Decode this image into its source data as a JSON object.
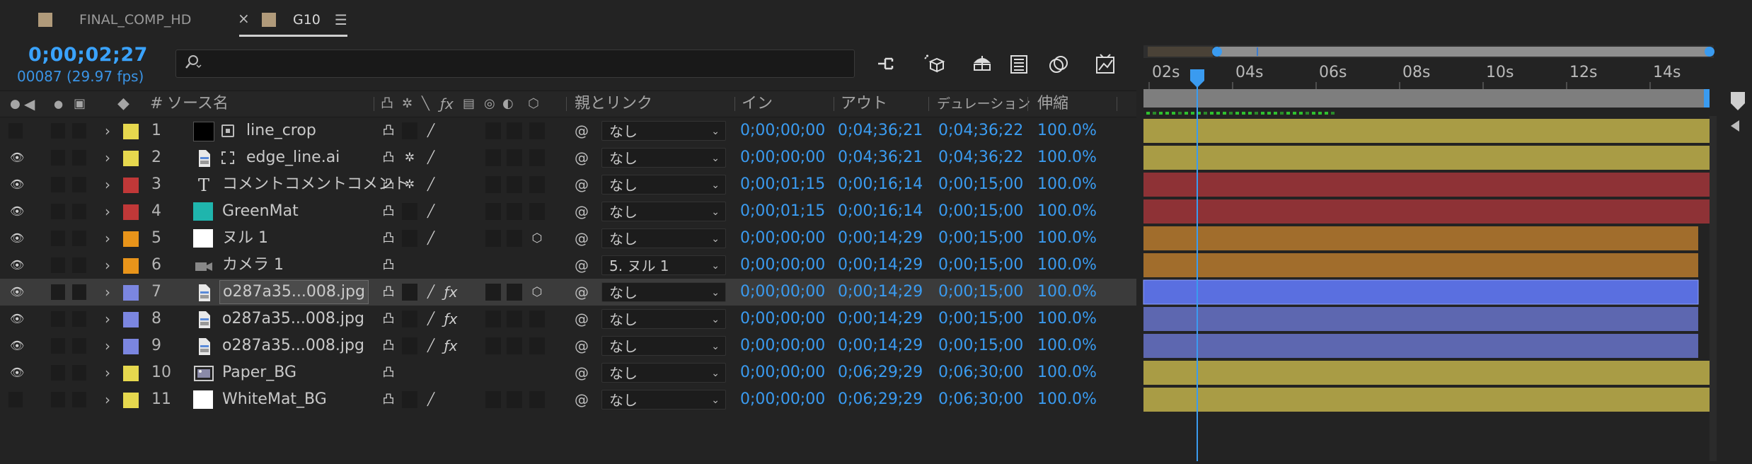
{
  "tabs": [
    {
      "label": "FINAL_COMP_HD",
      "active": false
    },
    {
      "label": "G10",
      "active": true
    }
  ],
  "tab_close_glyph": "×",
  "tab_menu_glyph": "☰",
  "header": {
    "timecode": "0;00;02;27",
    "frames": "00087 (29.97 fps)",
    "search_placeholder": ""
  },
  "columns": {
    "source_name": "ソース名",
    "parent_link": "親とリンク",
    "in": "イン",
    "out": "アウト",
    "duration": "デュレーション",
    "stretch": "伸縮",
    "num": "#"
  },
  "ruler": {
    "labels": [
      "02s",
      "04s",
      "06s",
      "08s",
      "10s",
      "12s",
      "14s"
    ]
  },
  "colors": {
    "yellow": "#e6d84e",
    "red": "#c03838",
    "teal": "#1fb5ad",
    "orange": "#e8941a",
    "blue": "#7b86e0",
    "bar_yellow": "#a99c45",
    "bar_red": "#8e3236",
    "bar_orange": "#a16d2c",
    "bar_blue": "#5d67b0",
    "bar_blue_sel": "#5a6fe0",
    "accent": "#3a9bf0"
  },
  "layers": [
    {
      "num": "1",
      "name": "line_crop",
      "label_color": "#e6d84e",
      "thumb": "black",
      "type_icon": "precomp",
      "parent": "なし",
      "in": "0;00;00;00",
      "out": "0;04;36;21",
      "duration": "0;04;36;22",
      "stretch": "100.0%",
      "eye": false,
      "switches": [
        "shy",
        "blank",
        "pen"
      ],
      "fx": false,
      "three_d": false,
      "bar_color": "#a99c45",
      "bar_end": 1.0,
      "selected": false
    },
    {
      "num": "2",
      "name": "edge_line.ai",
      "label_color": "#e6d84e",
      "thumb": "file",
      "type_icon": "ai",
      "parent": "なし",
      "in": "0;00;00;00",
      "out": "0;04;36;21",
      "duration": "0;04;36;22",
      "stretch": "100.0%",
      "eye": true,
      "switches": [
        "shy",
        "sun",
        "pen"
      ],
      "fx": false,
      "three_d": false,
      "bar_color": "#a99c45",
      "bar_end": 1.0,
      "selected": false
    },
    {
      "num": "3",
      "name": "コメントコメントコメント",
      "label_color": "#c03838",
      "thumb": "text",
      "type_icon": "",
      "parent": "なし",
      "in": "0;00;01;15",
      "out": "0;00;16;14",
      "duration": "0;00;15;00",
      "stretch": "100.0%",
      "eye": true,
      "switches": [
        "shy",
        "sun",
        "pen"
      ],
      "fx": false,
      "three_d": false,
      "bar_color": "#8e3236",
      "bar_end": 1.0,
      "selected": false
    },
    {
      "num": "4",
      "name": "GreenMat",
      "label_color": "#c03838",
      "thumb": "teal",
      "type_icon": "",
      "parent": "なし",
      "in": "0;00;01;15",
      "out": "0;00;16;14",
      "duration": "0;00;15;00",
      "stretch": "100.0%",
      "eye": true,
      "switches": [
        "shy",
        "blank",
        "pen"
      ],
      "fx": false,
      "three_d": false,
      "bar_color": "#8e3236",
      "bar_end": 1.0,
      "selected": false
    },
    {
      "num": "5",
      "name": "ヌル 1",
      "label_color": "#e8941a",
      "thumb": "white",
      "type_icon": "",
      "parent": "なし",
      "in": "0;00;00;00",
      "out": "0;00;14;29",
      "duration": "0;00;15;00",
      "stretch": "100.0%",
      "eye": true,
      "switches": [
        "shy",
        "blank",
        "pen"
      ],
      "fx": false,
      "three_d": true,
      "bar_color": "#a16d2c",
      "bar_end": 0.98,
      "selected": false
    },
    {
      "num": "6",
      "name": "カメラ 1",
      "label_color": "#e8941a",
      "thumb": "camera",
      "type_icon": "",
      "parent": "5. ヌル 1",
      "in": "0;00;00;00",
      "out": "0;00;14;29",
      "duration": "0;00;15;00",
      "stretch": "100.0%",
      "eye": true,
      "switches": [
        "shy"
      ],
      "fx": false,
      "three_d": false,
      "bar_color": "#a16d2c",
      "bar_end": 0.98,
      "selected": false
    },
    {
      "num": "7",
      "name": "o287a35...008.jpg",
      "label_color": "#7b86e0",
      "thumb": "file",
      "type_icon": "",
      "parent": "なし",
      "in": "0;00;00;00",
      "out": "0;00;14;29",
      "duration": "0;00;15;00",
      "stretch": "100.0%",
      "eye": true,
      "switches": [
        "shy",
        "blank",
        "pen"
      ],
      "fx": true,
      "three_d": true,
      "bar_color": "#5a6fe0",
      "bar_end": 0.98,
      "selected": true
    },
    {
      "num": "8",
      "name": "o287a35...008.jpg",
      "label_color": "#7b86e0",
      "thumb": "file",
      "type_icon": "",
      "parent": "なし",
      "in": "0;00;00;00",
      "out": "0;00;14;29",
      "duration": "0;00;15;00",
      "stretch": "100.0%",
      "eye": true,
      "switches": [
        "shy",
        "blank",
        "pen"
      ],
      "fx": true,
      "three_d": false,
      "bar_color": "#5d67b0",
      "bar_end": 0.98,
      "selected": false
    },
    {
      "num": "9",
      "name": "o287a35...008.jpg",
      "label_color": "#7b86e0",
      "thumb": "file",
      "type_icon": "",
      "parent": "なし",
      "in": "0;00;00;00",
      "out": "0;00;14;29",
      "duration": "0;00;15;00",
      "stretch": "100.0%",
      "eye": true,
      "switches": [
        "shy",
        "blank",
        "pen"
      ],
      "fx": true,
      "three_d": false,
      "bar_color": "#5d67b0",
      "bar_end": 0.98,
      "selected": false
    },
    {
      "num": "10",
      "name": "Paper_BG",
      "label_color": "#e6d84e",
      "thumb": "image",
      "type_icon": "",
      "parent": "なし",
      "in": "0;00;00;00",
      "out": "0;06;29;29",
      "duration": "0;06;30;00",
      "stretch": "100.0%",
      "eye": true,
      "switches": [
        "shy"
      ],
      "fx": false,
      "three_d": false,
      "bar_color": "#a99c45",
      "bar_end": 1.0,
      "selected": false
    },
    {
      "num": "11",
      "name": "WhiteMat_BG",
      "label_color": "#e6d84e",
      "thumb": "white",
      "type_icon": "",
      "parent": "なし",
      "in": "0;00;00;00",
      "out": "0;06;29;29",
      "duration": "0;06;30;00",
      "stretch": "100.0%",
      "eye": false,
      "switches": [
        "shy",
        "blank",
        "pen"
      ],
      "fx": false,
      "three_d": false,
      "bar_color": "#a99c45",
      "bar_end": 1.0,
      "selected": false
    }
  ]
}
